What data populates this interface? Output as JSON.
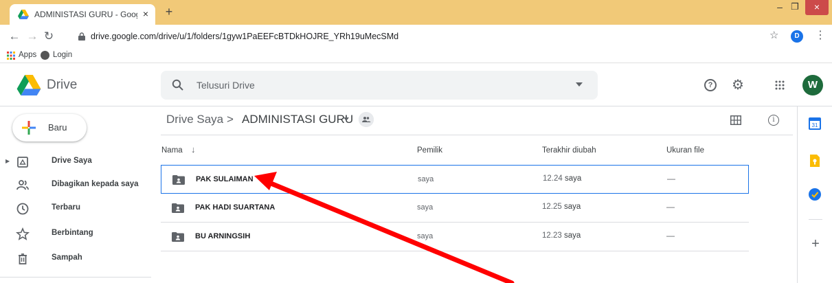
{
  "browser": {
    "tab_title": "ADMINISTASI GURU - Google Dr",
    "tab_close": "×",
    "new_tab": "+",
    "window_min": "–",
    "window_max": "❐",
    "window_close": "×",
    "url": "drive.google.com/drive/u/1/folders/1gyw1PaEEFcBTDkHOJRE_YRh19uMecSMd",
    "profile_initial": "D",
    "menu": "⋮",
    "bookmarks": [
      {
        "label": "Apps",
        "icon": "apps-icon"
      },
      {
        "label": "Login",
        "icon": "globe-icon"
      }
    ],
    "accent_tabstrip": "#f1c978"
  },
  "drive": {
    "app_name": "Drive",
    "search_placeholder": "Telusuri Drive",
    "account_initial": "W",
    "new_button": "Baru",
    "nav": [
      {
        "label": "Drive Saya",
        "icon": "my-drive-icon"
      },
      {
        "label": "Dibagikan kepada saya",
        "icon": "shared-with-me-icon"
      },
      {
        "label": "Terbaru",
        "icon": "recent-icon"
      },
      {
        "label": "Berbintang",
        "icon": "star-icon"
      },
      {
        "label": "Sampah",
        "icon": "trash-icon"
      }
    ],
    "breadcrumb": {
      "root": "Drive Saya",
      "separator": ">",
      "current": "ADMINISTASI GURU"
    },
    "columns": {
      "name": "Nama",
      "sort_arrow": "↓",
      "owner": "Pemilik",
      "modified": "Terakhir diubah",
      "size": "Ukuran file"
    },
    "files": [
      {
        "name": "PAK SULAIMAN",
        "owner": "saya",
        "modified_time": "12.24",
        "modified_by": "saya",
        "size": "—",
        "selected": true
      },
      {
        "name": "PAK HADI SUARTANA",
        "owner": "saya",
        "modified_time": "12.25",
        "modified_by": "saya",
        "size": "—",
        "selected": false
      },
      {
        "name": "BU ARNINGSIH",
        "owner": "saya",
        "modified_time": "12.23",
        "modified_by": "saya",
        "size": "—",
        "selected": false
      }
    ],
    "side_panel": {
      "calendar_day": "31",
      "add": "+"
    },
    "selection_color": "#1a73e8"
  },
  "annotation": {
    "arrow_color": "#ff0000",
    "points_to": "PAK SULAIMAN"
  }
}
